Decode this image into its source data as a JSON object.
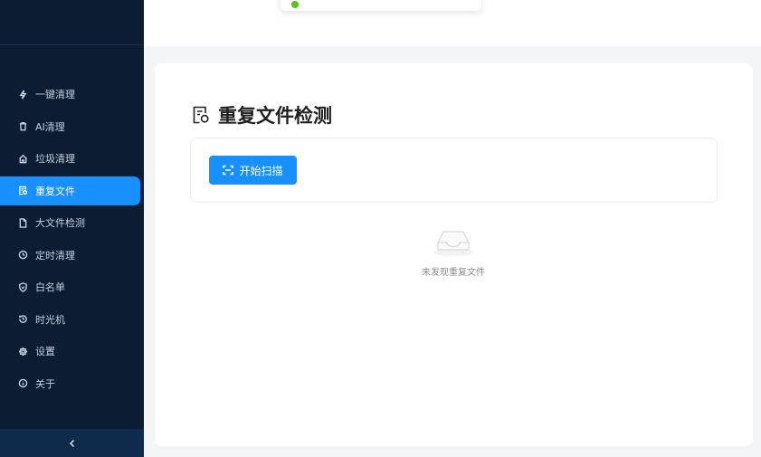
{
  "sidebar": {
    "items": [
      {
        "label": "一键清理",
        "icon": "lightning-icon",
        "active": false
      },
      {
        "label": "AI清理",
        "icon": "trash-icon",
        "active": false
      },
      {
        "label": "垃圾清理",
        "icon": "house-icon",
        "active": false
      },
      {
        "label": "重复文件",
        "icon": "duplicate-file-icon",
        "active": true
      },
      {
        "label": "大文件检测",
        "icon": "file-icon",
        "active": false
      },
      {
        "label": "定时清理",
        "icon": "clock-icon",
        "active": false
      },
      {
        "label": "白名单",
        "icon": "shield-icon",
        "active": false
      },
      {
        "label": "时光机",
        "icon": "history-icon",
        "active": false
      },
      {
        "label": "设置",
        "icon": "gear-icon",
        "active": false
      },
      {
        "label": "关于",
        "icon": "info-icon",
        "active": false
      }
    ],
    "collapse_icon": "chevron-left-icon"
  },
  "main": {
    "title": "重复文件检测",
    "title_icon": "duplicate-file-icon",
    "scan_button": "开始扫描",
    "empty_text": "未发现重复文件"
  },
  "colors": {
    "sidebar_bg": "#0b1c33",
    "accent": "#1890ff",
    "status_dot": "#52c41a"
  }
}
